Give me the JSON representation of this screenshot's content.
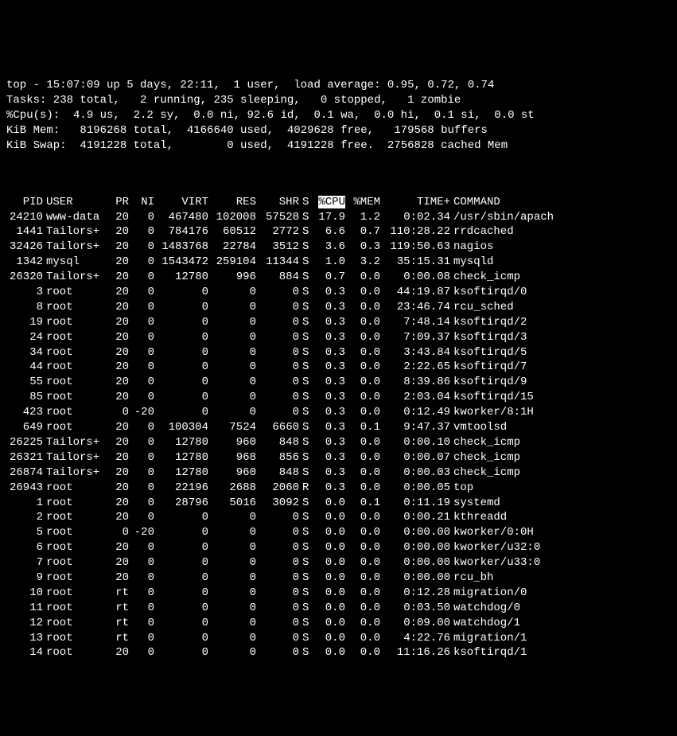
{
  "summary": {
    "line1": "top - 15:07:09 up 5 days, 22:11,  1 user,  load average: 0.95, 0.72, 0.74",
    "tasks": "Tasks: 238 total,   2 running, 235 sleeping,   0 stopped,   1 zombie",
    "cpu": "%Cpu(s):  4.9 us,  2.2 sy,  0.0 ni, 92.6 id,  0.1 wa,  0.0 hi,  0.1 si,  0.0 st",
    "mem": "KiB Mem:   8196268 total,  4166640 used,  4029628 free,   179568 buffers",
    "swap": "KiB Swap:  4191228 total,        0 used,  4191228 free.  2756828 cached Mem"
  },
  "columns": {
    "pid": "PID",
    "user": "USER",
    "pr": "PR",
    "ni": "NI",
    "virt": "VIRT",
    "res": "RES",
    "shr": "SHR",
    "s": "S",
    "cpu": "%CPU",
    "mem": "%MEM",
    "time": "TIME+",
    "cmd": "COMMAND"
  },
  "rows": [
    {
      "pid": "24210",
      "user": "www-data",
      "pr": "20",
      "ni": "0",
      "virt": "467480",
      "res": "102008",
      "shr": "57528",
      "s": "S",
      "cpu": "17.9",
      "mem": "1.2",
      "time": "0:02.34",
      "cmd": "/usr/sbin/apach"
    },
    {
      "pid": "1441",
      "user": "Tailors+",
      "pr": "20",
      "ni": "0",
      "virt": "784176",
      "res": "60512",
      "shr": "2772",
      "s": "S",
      "cpu": "6.6",
      "mem": "0.7",
      "time": "110:28.22",
      "cmd": "rrdcached"
    },
    {
      "pid": "32426",
      "user": "Tailors+",
      "pr": "20",
      "ni": "0",
      "virt": "1483768",
      "res": "22784",
      "shr": "3512",
      "s": "S",
      "cpu": "3.6",
      "mem": "0.3",
      "time": "119:50.63",
      "cmd": "nagios"
    },
    {
      "pid": "1342",
      "user": "mysql",
      "pr": "20",
      "ni": "0",
      "virt": "1543472",
      "res": "259104",
      "shr": "11344",
      "s": "S",
      "cpu": "1.0",
      "mem": "3.2",
      "time": "35:15.31",
      "cmd": "mysqld"
    },
    {
      "pid": "26320",
      "user": "Tailors+",
      "pr": "20",
      "ni": "0",
      "virt": "12780",
      "res": "996",
      "shr": "884",
      "s": "S",
      "cpu": "0.7",
      "mem": "0.0",
      "time": "0:00.08",
      "cmd": "check_icmp"
    },
    {
      "pid": "3",
      "user": "root",
      "pr": "20",
      "ni": "0",
      "virt": "0",
      "res": "0",
      "shr": "0",
      "s": "S",
      "cpu": "0.3",
      "mem": "0.0",
      "time": "44:19.87",
      "cmd": "ksoftirqd/0"
    },
    {
      "pid": "8",
      "user": "root",
      "pr": "20",
      "ni": "0",
      "virt": "0",
      "res": "0",
      "shr": "0",
      "s": "S",
      "cpu": "0.3",
      "mem": "0.0",
      "time": "23:46.74",
      "cmd": "rcu_sched"
    },
    {
      "pid": "19",
      "user": "root",
      "pr": "20",
      "ni": "0",
      "virt": "0",
      "res": "0",
      "shr": "0",
      "s": "S",
      "cpu": "0.3",
      "mem": "0.0",
      "time": "7:48.14",
      "cmd": "ksoftirqd/2"
    },
    {
      "pid": "24",
      "user": "root",
      "pr": "20",
      "ni": "0",
      "virt": "0",
      "res": "0",
      "shr": "0",
      "s": "S",
      "cpu": "0.3",
      "mem": "0.0",
      "time": "7:09.37",
      "cmd": "ksoftirqd/3"
    },
    {
      "pid": "34",
      "user": "root",
      "pr": "20",
      "ni": "0",
      "virt": "0",
      "res": "0",
      "shr": "0",
      "s": "S",
      "cpu": "0.3",
      "mem": "0.0",
      "time": "3:43.84",
      "cmd": "ksoftirqd/5"
    },
    {
      "pid": "44",
      "user": "root",
      "pr": "20",
      "ni": "0",
      "virt": "0",
      "res": "0",
      "shr": "0",
      "s": "S",
      "cpu": "0.3",
      "mem": "0.0",
      "time": "2:22.65",
      "cmd": "ksoftirqd/7"
    },
    {
      "pid": "55",
      "user": "root",
      "pr": "20",
      "ni": "0",
      "virt": "0",
      "res": "0",
      "shr": "0",
      "s": "S",
      "cpu": "0.3",
      "mem": "0.0",
      "time": "8:39.86",
      "cmd": "ksoftirqd/9"
    },
    {
      "pid": "85",
      "user": "root",
      "pr": "20",
      "ni": "0",
      "virt": "0",
      "res": "0",
      "shr": "0",
      "s": "S",
      "cpu": "0.3",
      "mem": "0.0",
      "time": "2:03.04",
      "cmd": "ksoftirqd/15"
    },
    {
      "pid": "423",
      "user": "root",
      "pr": "0",
      "ni": "-20",
      "virt": "0",
      "res": "0",
      "shr": "0",
      "s": "S",
      "cpu": "0.3",
      "mem": "0.0",
      "time": "0:12.49",
      "cmd": "kworker/8:1H"
    },
    {
      "pid": "649",
      "user": "root",
      "pr": "20",
      "ni": "0",
      "virt": "100304",
      "res": "7524",
      "shr": "6660",
      "s": "S",
      "cpu": "0.3",
      "mem": "0.1",
      "time": "9:47.37",
      "cmd": "vmtoolsd"
    },
    {
      "pid": "26225",
      "user": "Tailors+",
      "pr": "20",
      "ni": "0",
      "virt": "12780",
      "res": "960",
      "shr": "848",
      "s": "S",
      "cpu": "0.3",
      "mem": "0.0",
      "time": "0:00.10",
      "cmd": "check_icmp"
    },
    {
      "pid": "26321",
      "user": "Tailors+",
      "pr": "20",
      "ni": "0",
      "virt": "12780",
      "res": "968",
      "shr": "856",
      "s": "S",
      "cpu": "0.3",
      "mem": "0.0",
      "time": "0:00.07",
      "cmd": "check_icmp"
    },
    {
      "pid": "26874",
      "user": "Tailors+",
      "pr": "20",
      "ni": "0",
      "virt": "12780",
      "res": "960",
      "shr": "848",
      "s": "S",
      "cpu": "0.3",
      "mem": "0.0",
      "time": "0:00.03",
      "cmd": "check_icmp"
    },
    {
      "pid": "26943",
      "user": "root",
      "pr": "20",
      "ni": "0",
      "virt": "22196",
      "res": "2688",
      "shr": "2060",
      "s": "R",
      "cpu": "0.3",
      "mem": "0.0",
      "time": "0:00.05",
      "cmd": "top",
      "bold": true
    },
    {
      "pid": "1",
      "user": "root",
      "pr": "20",
      "ni": "0",
      "virt": "28796",
      "res": "5016",
      "shr": "3092",
      "s": "S",
      "cpu": "0.0",
      "mem": "0.1",
      "time": "0:11.19",
      "cmd": "systemd"
    },
    {
      "pid": "2",
      "user": "root",
      "pr": "20",
      "ni": "0",
      "virt": "0",
      "res": "0",
      "shr": "0",
      "s": "S",
      "cpu": "0.0",
      "mem": "0.0",
      "time": "0:00.21",
      "cmd": "kthreadd"
    },
    {
      "pid": "5",
      "user": "root",
      "pr": "0",
      "ni": "-20",
      "virt": "0",
      "res": "0",
      "shr": "0",
      "s": "S",
      "cpu": "0.0",
      "mem": "0.0",
      "time": "0:00.00",
      "cmd": "kworker/0:0H"
    },
    {
      "pid": "6",
      "user": "root",
      "pr": "20",
      "ni": "0",
      "virt": "0",
      "res": "0",
      "shr": "0",
      "s": "S",
      "cpu": "0.0",
      "mem": "0.0",
      "time": "0:00.00",
      "cmd": "kworker/u32:0"
    },
    {
      "pid": "7",
      "user": "root",
      "pr": "20",
      "ni": "0",
      "virt": "0",
      "res": "0",
      "shr": "0",
      "s": "S",
      "cpu": "0.0",
      "mem": "0.0",
      "time": "0:00.00",
      "cmd": "kworker/u33:0"
    },
    {
      "pid": "9",
      "user": "root",
      "pr": "20",
      "ni": "0",
      "virt": "0",
      "res": "0",
      "shr": "0",
      "s": "S",
      "cpu": "0.0",
      "mem": "0.0",
      "time": "0:00.00",
      "cmd": "rcu_bh"
    },
    {
      "pid": "10",
      "user": "root",
      "pr": "rt",
      "ni": "0",
      "virt": "0",
      "res": "0",
      "shr": "0",
      "s": "S",
      "cpu": "0.0",
      "mem": "0.0",
      "time": "0:12.28",
      "cmd": "migration/0"
    },
    {
      "pid": "11",
      "user": "root",
      "pr": "rt",
      "ni": "0",
      "virt": "0",
      "res": "0",
      "shr": "0",
      "s": "S",
      "cpu": "0.0",
      "mem": "0.0",
      "time": "0:03.50",
      "cmd": "watchdog/0"
    },
    {
      "pid": "12",
      "user": "root",
      "pr": "rt",
      "ni": "0",
      "virt": "0",
      "res": "0",
      "shr": "0",
      "s": "S",
      "cpu": "0.0",
      "mem": "0.0",
      "time": "0:09.00",
      "cmd": "watchdog/1"
    },
    {
      "pid": "13",
      "user": "root",
      "pr": "rt",
      "ni": "0",
      "virt": "0",
      "res": "0",
      "shr": "0",
      "s": "S",
      "cpu": "0.0",
      "mem": "0.0",
      "time": "4:22.76",
      "cmd": "migration/1"
    },
    {
      "pid": "14",
      "user": "root",
      "pr": "20",
      "ni": "0",
      "virt": "0",
      "res": "0",
      "shr": "0",
      "s": "S",
      "cpu": "0.0",
      "mem": "0.0",
      "time": "11:16.26",
      "cmd": "ksoftirqd/1"
    }
  ]
}
